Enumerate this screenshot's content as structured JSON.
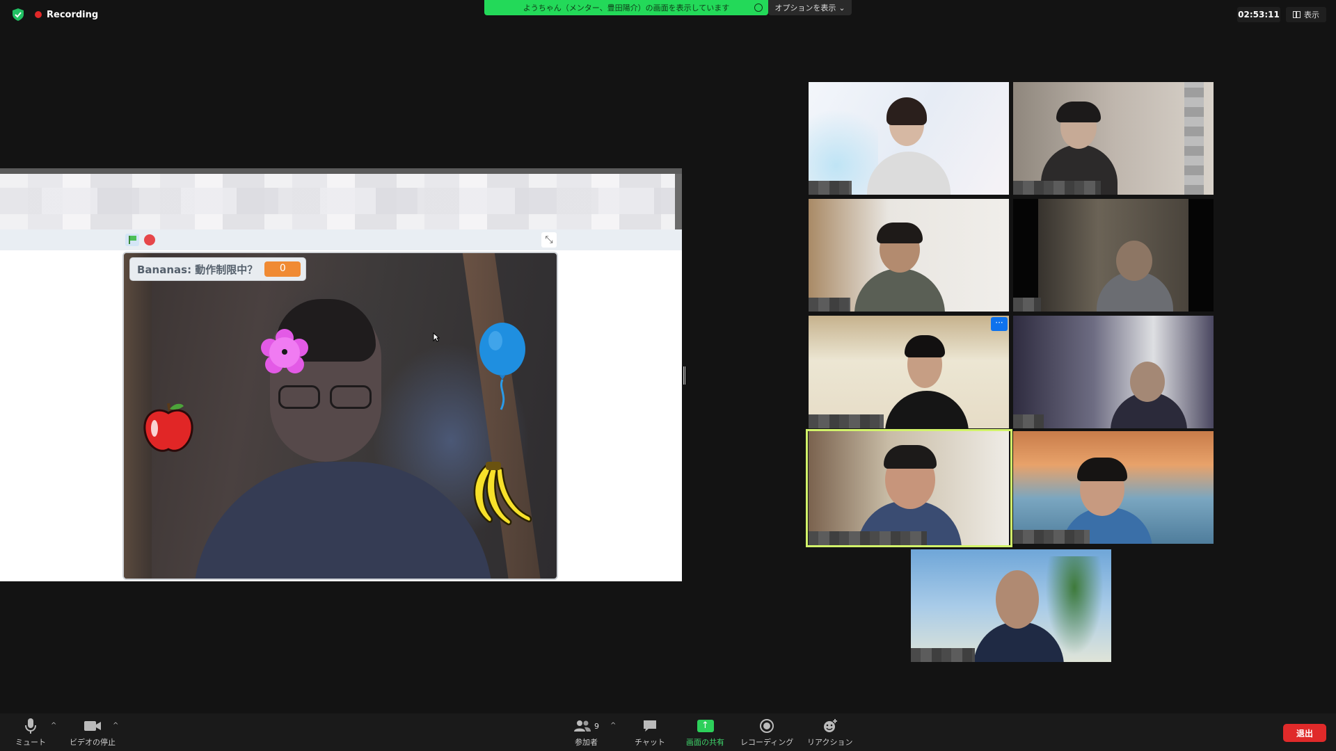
{
  "topbar": {
    "recording_label": "Recording",
    "share_banner": "ようちゃん（メンター、豊田陽介）の画面を表示しています",
    "options_label": "オプションを表示",
    "clock": "02:53:11",
    "view_label": "表示"
  },
  "scratch": {
    "variable_name": "Bananas: 動作制限中？",
    "variable_value": "0"
  },
  "toolbar": {
    "mute_label": "ミュート",
    "video_label": "ビデオの停止",
    "participants_label": "参加者",
    "participants_count": "9",
    "chat_label": "チャット",
    "share_label": "画面の共有",
    "record_label": "レコーディング",
    "reaction_label": "リアクション",
    "leave_label": "退出"
  },
  "colors": {
    "share_green": "#23d959",
    "leave_red": "#e02a2a",
    "active_speaker": "#d2f36a",
    "zoom_blue": "#0e72ed"
  }
}
